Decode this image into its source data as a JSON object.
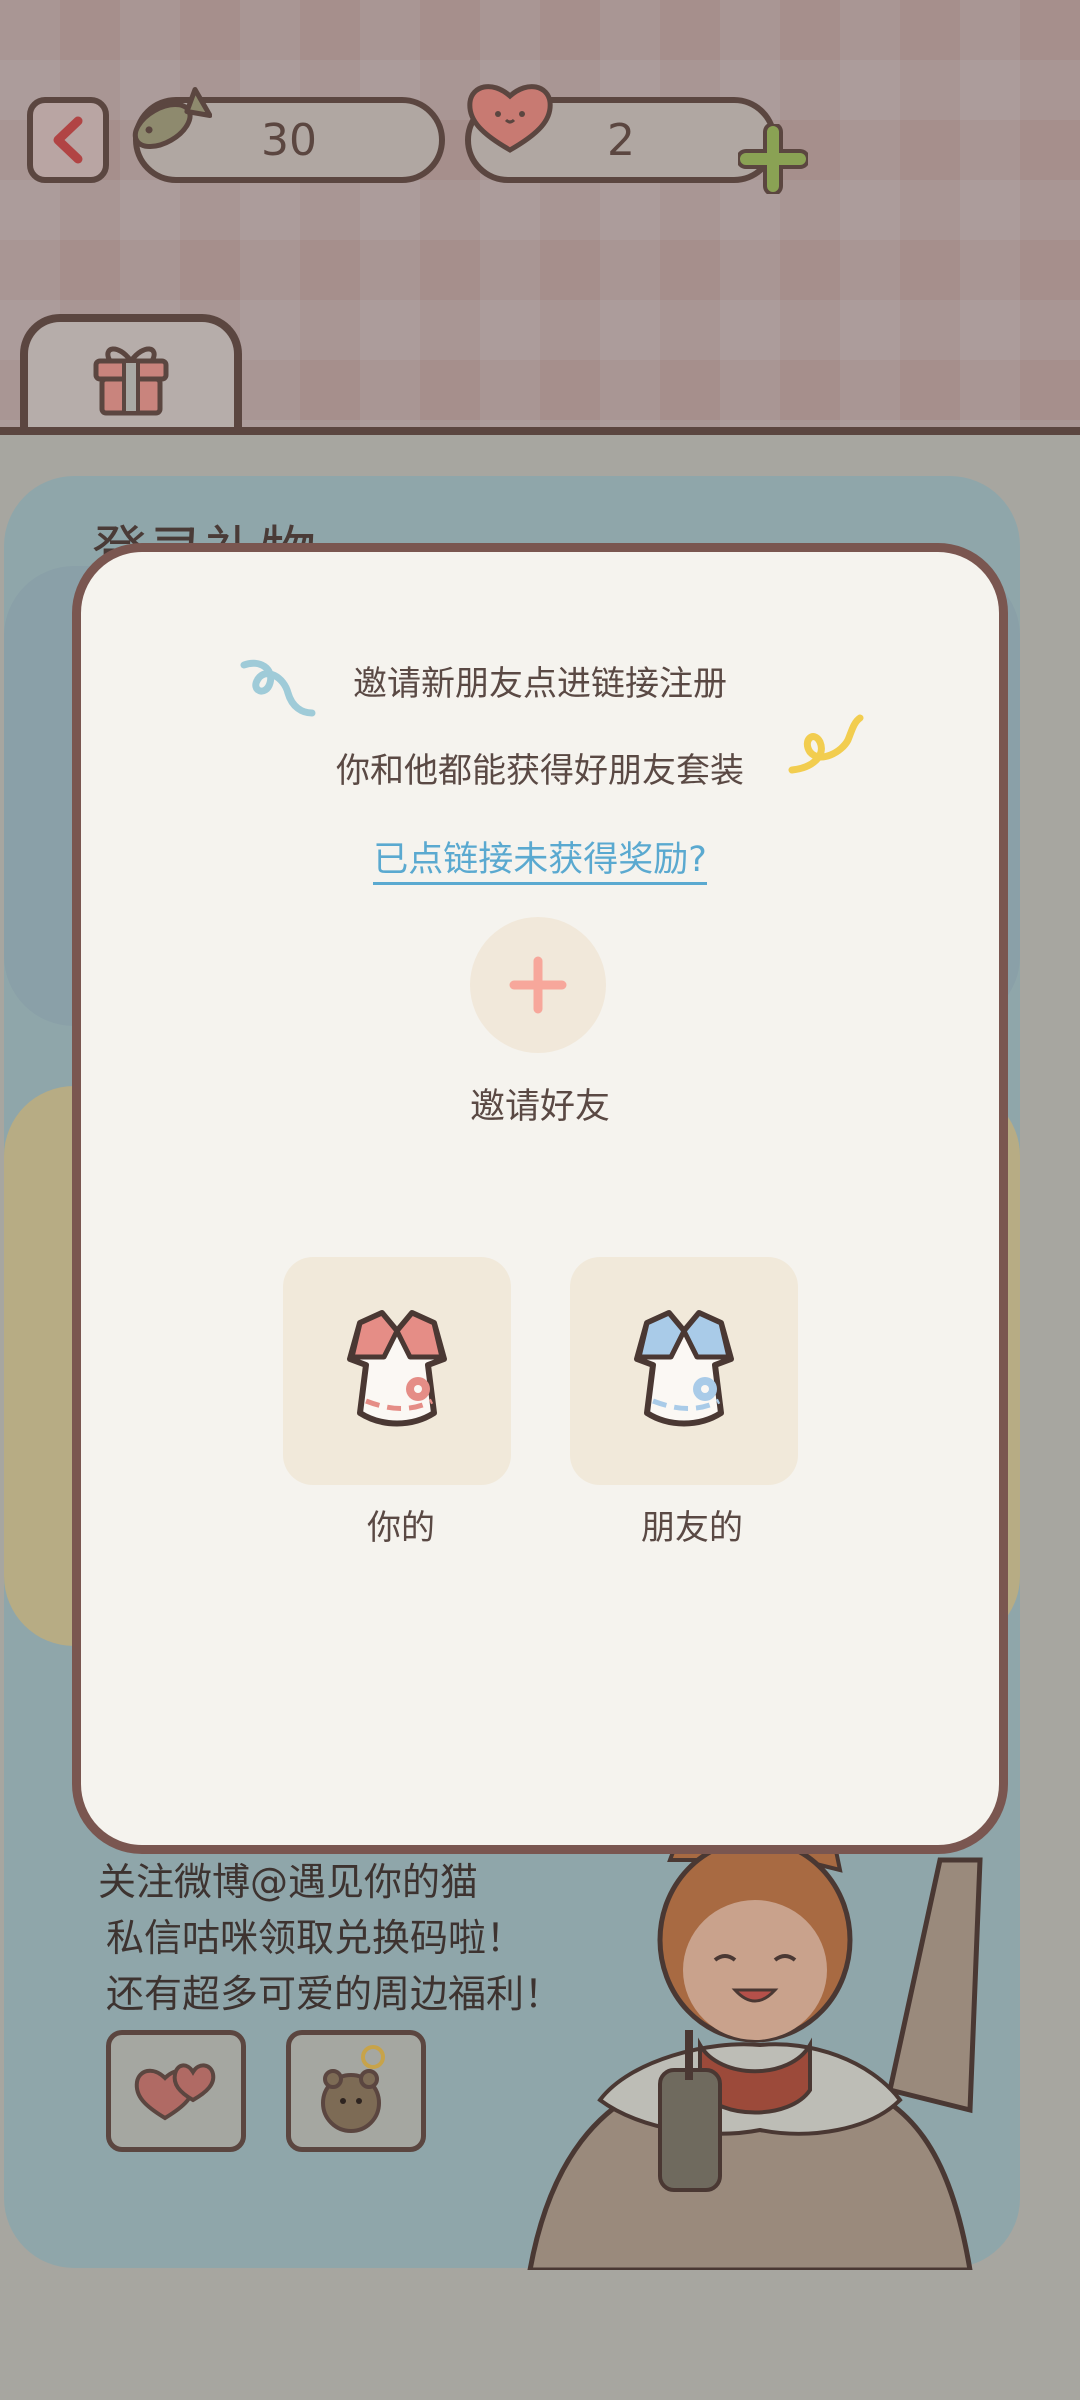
{
  "header": {
    "fish_count": "30",
    "heart_count": "2"
  },
  "background": {
    "section_title": "登录礼物",
    "promo_lines": [
      "关注微博@遇见你的猫",
      "私信咕咪领取兑换码啦！",
      "还有超多可爱的周边福利！"
    ]
  },
  "modal": {
    "line1": "邀请新朋友点进链接注册",
    "line2": "你和他都能获得好朋友套装",
    "help_link": "已点链接未获得奖励?",
    "invite_label": "邀请好友",
    "reward_you_label": "你的",
    "reward_friend_label": "朋友的"
  },
  "colors": {
    "outline": "#5b4640",
    "modal_bg": "#f5f3ee",
    "link": "#5aa9d0",
    "plus": "#f7a79b",
    "outfit_you": "#e58d86",
    "outfit_friend": "#a9cbe8"
  },
  "icons": [
    "back-arrow-icon",
    "fish-icon",
    "heart-icon",
    "plus-icon",
    "gift-icon",
    "add-friend-icon",
    "dress-pink-icon",
    "dress-blue-icon",
    "ribbon-blue-icon",
    "ribbon-yellow-icon"
  ]
}
